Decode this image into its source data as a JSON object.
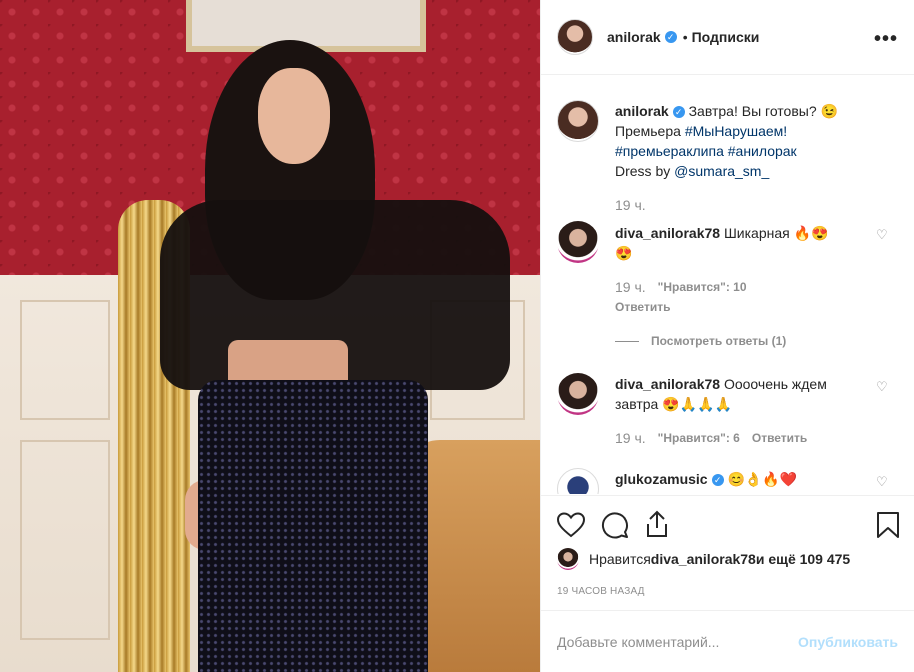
{
  "post": {
    "author": "anilorak",
    "separator": "•",
    "follow_label": "Подписки",
    "more_label": "•••"
  },
  "caption": {
    "author": "anilorak",
    "text1": "Завтра! Вы готовы? 😉",
    "text2": "Премьера ",
    "tag1": "#МыНарушаем!",
    "tag2": "#премьераклипа",
    "tag3": "#анилорак",
    "dress": "Dress by ",
    "mention": "@sumara_sm_",
    "time": "19 ч."
  },
  "comments": [
    {
      "user": "diva_anilorak78",
      "text": "Шикарная 🔥😍",
      "text2": "😍",
      "time": "19 ч.",
      "likes": "\"Нравится\": 10",
      "reply": "Ответить",
      "view_replies": "Посмотреть ответы (1)"
    },
    {
      "user": "diva_anilorak78",
      "text": "Оооочень ждем",
      "text2": "завтра 😍🙏🙏🙏",
      "time": "19 ч.",
      "likes": "\"Нравится\": 6",
      "reply": "Ответить"
    },
    {
      "user": "glukozamusic",
      "text": "😊👌🔥❤️"
    }
  ],
  "likes": {
    "prefix": "Нравится ",
    "user": "diva_anilorak78",
    "suffix": " и ещё 109 475"
  },
  "time_ago": "19 ЧАСОВ НАЗАД",
  "add_comment": {
    "placeholder": "Добавьте комментарий...",
    "publish": "Опубликовать"
  },
  "colors": {
    "verified": "#3897f0",
    "link": "#003569",
    "muted": "#8e8e8e",
    "publish_disabled": "#b2dffc"
  },
  "icons": {
    "like": "heart-icon",
    "comment": "comment-icon",
    "share": "share-icon",
    "save": "bookmark-icon",
    "more": "more-icon"
  }
}
